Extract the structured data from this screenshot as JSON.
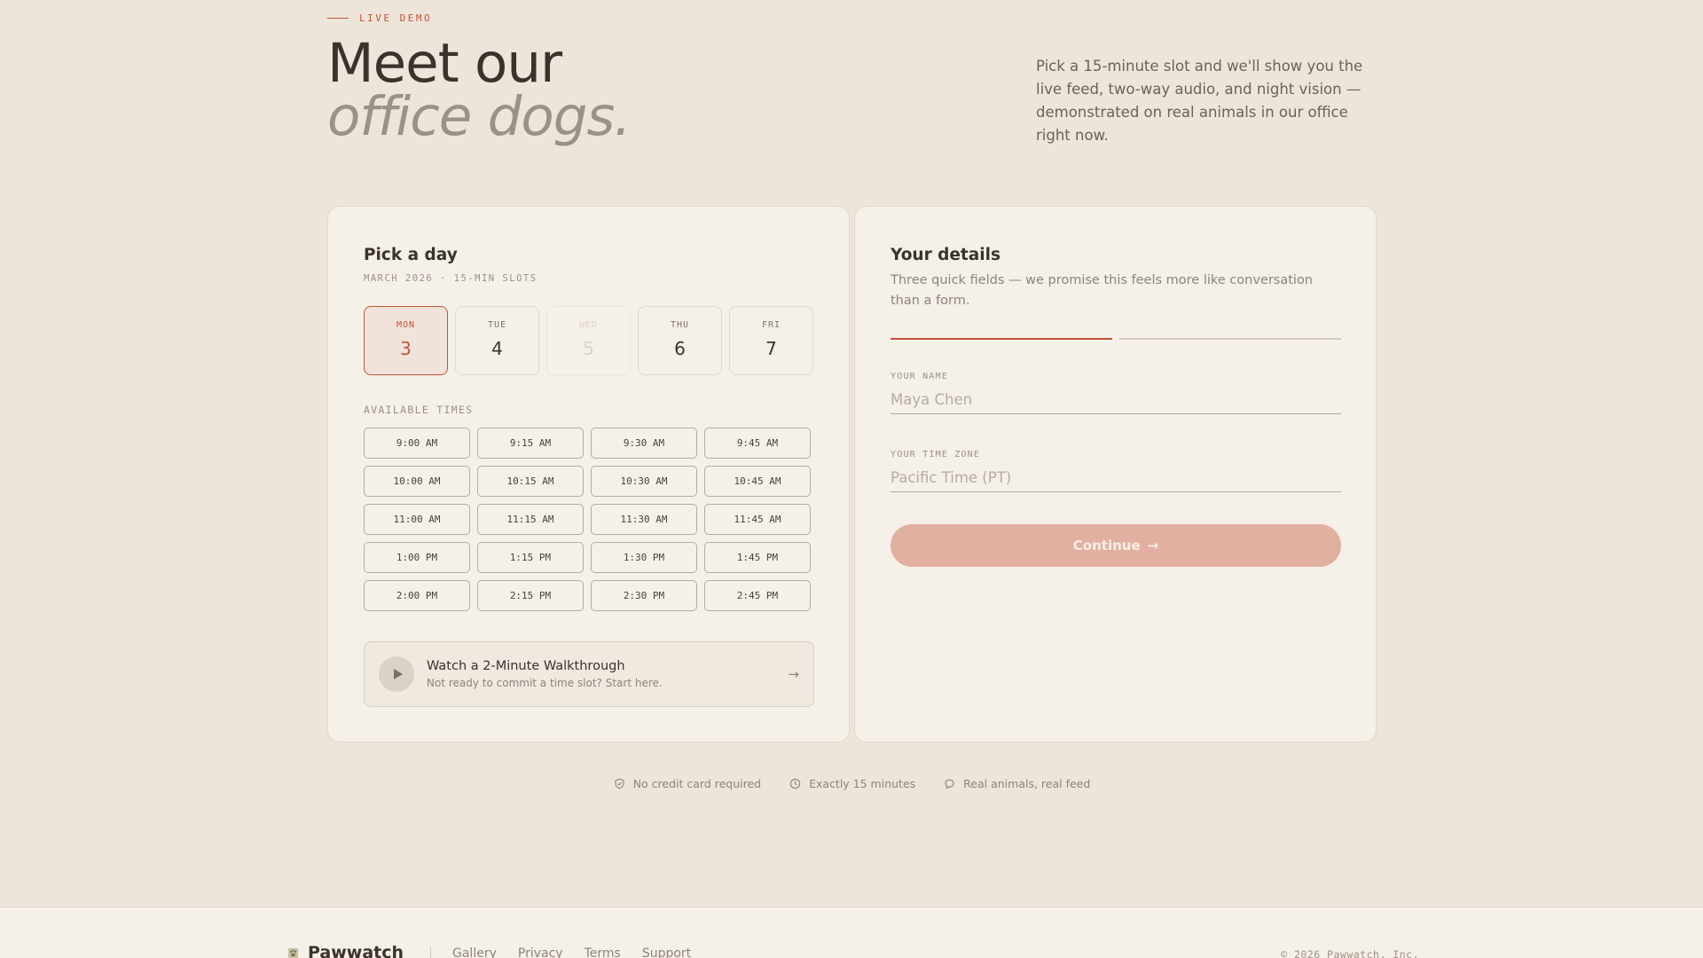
{
  "hero": {
    "eyebrow": "LIVE DEMO",
    "title_line1": "Meet our",
    "title_line2": "office dogs.",
    "lede": "Pick a 15-minute slot and we'll show you the live feed, two-way audio, and night vision — demonstrated on real animals in our office right now."
  },
  "schedule": {
    "title": "Pick a day",
    "subtitle": "MARCH 2026 · 15-MIN SLOTS",
    "days": [
      {
        "dow": "MON",
        "num": "3",
        "state": "selected"
      },
      {
        "dow": "TUE",
        "num": "4",
        "state": "available"
      },
      {
        "dow": "WED",
        "num": "5",
        "state": "disabled"
      },
      {
        "dow": "THU",
        "num": "6",
        "state": "available"
      },
      {
        "dow": "FRI",
        "num": "7",
        "state": "available"
      }
    ],
    "times_label": "AVAILABLE TIMES",
    "times": [
      "9:00 AM",
      "9:15 AM",
      "9:30 AM",
      "9:45 AM",
      "10:00 AM",
      "10:15 AM",
      "10:30 AM",
      "10:45 AM",
      "11:00 AM",
      "11:15 AM",
      "11:30 AM",
      "11:45 AM",
      "1:00 PM",
      "1:15 PM",
      "1:30 PM",
      "1:45 PM",
      "2:00 PM",
      "2:15 PM",
      "2:30 PM",
      "2:45 PM"
    ],
    "walkthrough": {
      "title": "Watch a 2-Minute Walkthrough",
      "subtitle": "Not ready to commit a time slot? Start here.",
      "icon": "play-icon",
      "arrow": "→"
    }
  },
  "details": {
    "title": "Your details",
    "subtitle": "Three quick fields — we promise this feels more like conversation than a form.",
    "progress_step": 1,
    "progress_total": 2,
    "name_label": "YOUR NAME",
    "name_placeholder": "Maya Chen",
    "name_value": "",
    "tz_label": "YOUR TIME ZONE",
    "tz_placeholder": "Pacific Time (PT)",
    "tz_value": "",
    "continue_label": "Continue",
    "continue_arrow": "→"
  },
  "assurances": [
    {
      "icon": "shield-icon",
      "text": "No credit card required"
    },
    {
      "icon": "clock-icon",
      "text": "Exactly 15 minutes"
    },
    {
      "icon": "chat-icon",
      "text": "Real animals, real feed"
    }
  ],
  "footer": {
    "brand": "Pawwatch",
    "links": [
      "Gallery",
      "Privacy",
      "Terms",
      "Support"
    ],
    "copyright": "© 2026 Pawwatch, Inc."
  },
  "colors": {
    "accent": "#c0553a",
    "background": "#ede5d9",
    "card": "#f5f0e8",
    "button_disabled": "#e2b0a0"
  }
}
